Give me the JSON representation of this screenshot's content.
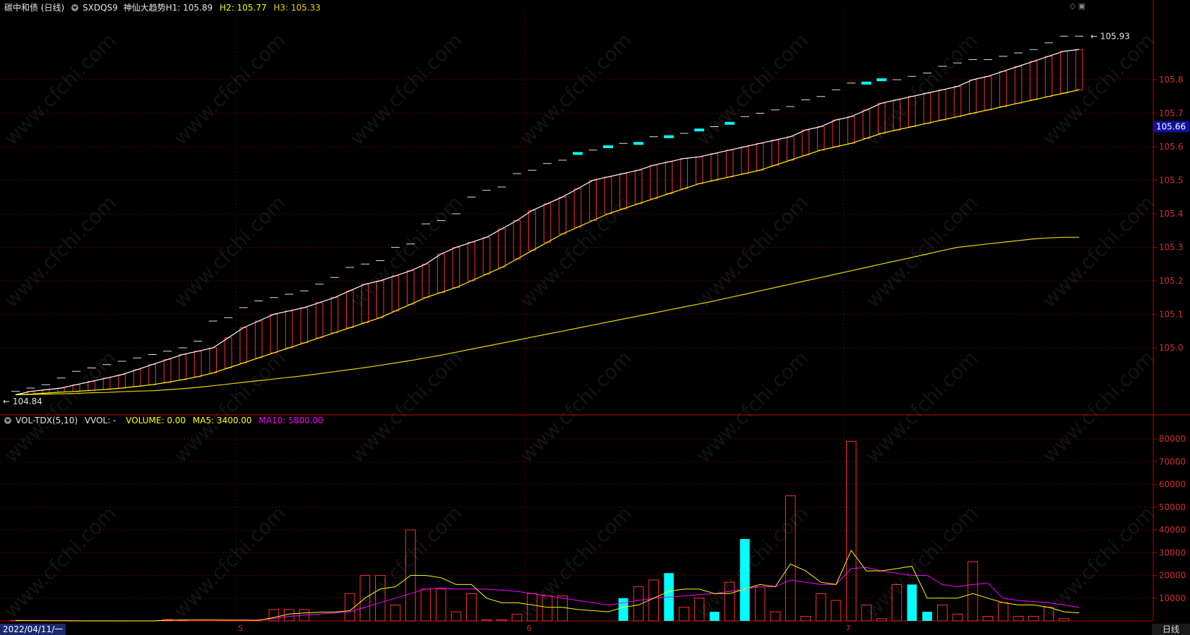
{
  "header": {
    "security": "碳中和债 (日线)",
    "indicator": "SXDQS9",
    "indicator_title": "神仙大趋势",
    "h1_label": "H1: 105.89",
    "h2_label": "H2: 105.77",
    "h3_label": "H3: 105.33"
  },
  "vol_header": {
    "name": "VOL-TDX(5,10)",
    "vvol": "VVOL: -",
    "volume": "VOLUME: 0.00",
    "ma5": "MA5: 3400.00",
    "ma10": "MA10: 5800.00"
  },
  "watermark": "www.cfchi.com",
  "cursor_date": "2022/04/11/一",
  "period": "日线",
  "colors": {
    "up": "#ff3030",
    "down": "#00ffff",
    "h1": "#ffffff",
    "h2": "#ffff00",
    "h3": "#e8d800",
    "ma10": "#ff00ff",
    "grid": "#5a0000",
    "axis": "#c00000"
  },
  "chart_data": [
    {
      "type": "line",
      "title": "SXDQS9 神仙大趋势",
      "y_axis_side": "right",
      "ylim": [
        104.8,
        106.0
      ],
      "y_ticks": [
        "105.0",
        "105.1",
        "105.2",
        "105.3",
        "105.4",
        "105.5",
        "105.6",
        "105.7",
        "105.8"
      ],
      "x_labels": [
        "5",
        "6",
        "7"
      ],
      "x_label_index": [
        15,
        34,
        55
      ],
      "last_price_tag": "105.66",
      "high_annotation": "105.93",
      "low_annotation": "104.84",
      "series": [
        {
          "name": "H1",
          "values": [
            104.86,
            104.87,
            104.875,
            104.88,
            104.89,
            104.9,
            104.91,
            104.92,
            104.935,
            104.95,
            104.965,
            104.98,
            104.99,
            105.0,
            105.03,
            105.06,
            105.08,
            105.1,
            105.11,
            105.12,
            105.135,
            105.15,
            105.17,
            105.19,
            105.2,
            105.215,
            105.23,
            105.25,
            105.28,
            105.3,
            105.315,
            105.33,
            105.355,
            105.38,
            105.41,
            105.43,
            105.45,
            105.475,
            105.5,
            105.51,
            105.52,
            105.53,
            105.545,
            105.555,
            105.565,
            105.57,
            105.58,
            105.59,
            105.6,
            105.61,
            105.62,
            105.63,
            105.65,
            105.66,
            105.68,
            105.69,
            105.71,
            105.73,
            105.74,
            105.75,
            105.76,
            105.77,
            105.78,
            105.8,
            105.81,
            105.825,
            105.84,
            105.855,
            105.87,
            105.885,
            105.89
          ]
        },
        {
          "name": "H2",
          "values": [
            104.86,
            104.862,
            104.865,
            104.868,
            104.87,
            104.873,
            104.876,
            104.88,
            104.885,
            104.89,
            104.897,
            104.905,
            104.914,
            104.925,
            104.94,
            104.955,
            104.97,
            104.985,
            105.0,
            105.015,
            105.03,
            105.045,
            105.06,
            105.075,
            105.09,
            105.11,
            105.13,
            105.15,
            105.165,
            105.18,
            105.2,
            105.22,
            105.24,
            105.265,
            105.29,
            105.315,
            105.34,
            105.36,
            105.38,
            105.4,
            105.415,
            105.43,
            105.445,
            105.46,
            105.475,
            105.49,
            105.5,
            105.51,
            105.52,
            105.53,
            105.545,
            105.56,
            105.575,
            105.59,
            105.6,
            105.61,
            105.625,
            105.64,
            105.65,
            105.66,
            105.67,
            105.68,
            105.69,
            105.7,
            105.71,
            105.72,
            105.73,
            105.74,
            105.75,
            105.76,
            105.77
          ]
        },
        {
          "name": "H3",
          "values": [
            104.86,
            104.861,
            104.862,
            104.863,
            104.864,
            104.866,
            104.867,
            104.869,
            104.871,
            104.872,
            104.875,
            104.878,
            104.882,
            104.887,
            104.892,
            104.897,
            104.902,
            104.907,
            104.912,
            104.917,
            104.923,
            104.929,
            104.935,
            104.941,
            104.948,
            104.955,
            104.962,
            104.97,
            104.978,
            104.987,
            104.996,
            105.005,
            105.014,
            105.023,
            105.032,
            105.041,
            105.05,
            105.059,
            105.068,
            105.077,
            105.086,
            105.095,
            105.104,
            105.113,
            105.122,
            105.131,
            105.14,
            105.15,
            105.16,
            105.17,
            105.18,
            105.19,
            105.2,
            105.21,
            105.22,
            105.23,
            105.24,
            105.25,
            105.26,
            105.27,
            105.28,
            105.29,
            105.3,
            105.305,
            105.31,
            105.315,
            105.32,
            105.325,
            105.328,
            105.33,
            105.33
          ]
        }
      ],
      "markers": {
        "name": "dash",
        "values": [
          104.87,
          104.88,
          104.89,
          104.91,
          104.93,
          104.94,
          104.95,
          104.96,
          104.97,
          104.98,
          104.99,
          105.0,
          105.02,
          105.08,
          105.09,
          105.12,
          105.14,
          105.15,
          105.16,
          105.17,
          105.19,
          105.21,
          105.24,
          105.25,
          105.26,
          105.3,
          105.31,
          105.37,
          105.38,
          105.4,
          105.45,
          105.47,
          105.48,
          105.52,
          105.53,
          105.55,
          105.56,
          105.58,
          105.59,
          105.6,
          105.61,
          105.61,
          105.63,
          105.63,
          105.64,
          105.65,
          105.66,
          105.67,
          105.69,
          105.7,
          105.71,
          105.72,
          105.74,
          105.75,
          105.77,
          105.79,
          105.79,
          105.8,
          105.8,
          105.81,
          105.82,
          105.84,
          105.85,
          105.86,
          105.86,
          105.87,
          105.88,
          105.89,
          105.91,
          105.93,
          105.93
        ],
        "highlight_index": [
          37,
          39,
          41,
          43,
          45,
          47,
          56,
          57
        ]
      }
    },
    {
      "type": "bar",
      "title": "VOL-TDX(5,10)",
      "y_axis_side": "right",
      "ylim": [
        0,
        85000
      ],
      "y_ticks": [
        "10000",
        "20000",
        "30000",
        "40000",
        "50000",
        "60000",
        "70000",
        "80000"
      ],
      "series": [
        {
          "name": "VOLUME",
          "values": [
            200,
            0,
            0,
            0,
            0,
            0,
            0,
            0,
            0,
            0,
            600,
            400,
            0,
            0,
            0,
            0,
            0,
            5000,
            5000,
            5000,
            0,
            0,
            12000,
            20000,
            20000,
            7000,
            40000,
            14000,
            14000,
            4000,
            12000,
            500,
            500,
            3000,
            12000,
            11000,
            11000,
            0,
            0,
            0,
            10000,
            15000,
            18000,
            21000,
            6000,
            10000,
            4000,
            17000,
            36000,
            15000,
            4000,
            55000,
            2000,
            12000,
            9000,
            79000,
            7000,
            1000,
            16000,
            16000,
            4000,
            7000,
            3000,
            26000,
            2000,
            8000,
            2000,
            2000,
            6000,
            1000,
            0
          ],
          "down_index": [
            40,
            43,
            46,
            48,
            59,
            60
          ]
        },
        {
          "name": "MA5",
          "values": [
            200,
            150,
            100,
            50,
            0,
            0,
            0,
            0,
            0,
            0,
            300,
            400,
            400,
            400,
            300,
            300,
            200,
            1500,
            3000,
            3500,
            3800,
            3900,
            4500,
            10000,
            14000,
            15000,
            20000,
            20000,
            19000,
            16000,
            16000,
            10000,
            8000,
            8000,
            7000,
            6000,
            6000,
            5000,
            4500,
            4000,
            6000,
            7000,
            10000,
            13000,
            14000,
            14000,
            12000,
            12000,
            14000,
            16000,
            15000,
            25000,
            22000,
            17000,
            16000,
            31000,
            22000,
            22000,
            23000,
            24000,
            10000,
            10000,
            10000,
            12000,
            10000,
            8000,
            7000,
            7000,
            6000,
            4000,
            3500
          ]
        },
        {
          "name": "MA10",
          "values": [
            200,
            180,
            160,
            140,
            120,
            100,
            80,
            60,
            40,
            20,
            200,
            300,
            350,
            400,
            400,
            400,
            400,
            1000,
            2000,
            2500,
            3000,
            3500,
            4000,
            6000,
            8000,
            10000,
            12000,
            14000,
            14500,
            14000,
            14000,
            14000,
            13500,
            13000,
            12000,
            11000,
            10000,
            9000,
            8000,
            7000,
            8000,
            9000,
            10000,
            10500,
            11000,
            11500,
            12000,
            13000,
            14000,
            15000,
            15000,
            18000,
            17000,
            16000,
            16000,
            23000,
            23500,
            22000,
            21000,
            20000,
            20000,
            16000,
            15000,
            16000,
            16500,
            10000,
            9000,
            8500,
            8000,
            7000,
            6000
          ]
        }
      ]
    }
  ]
}
